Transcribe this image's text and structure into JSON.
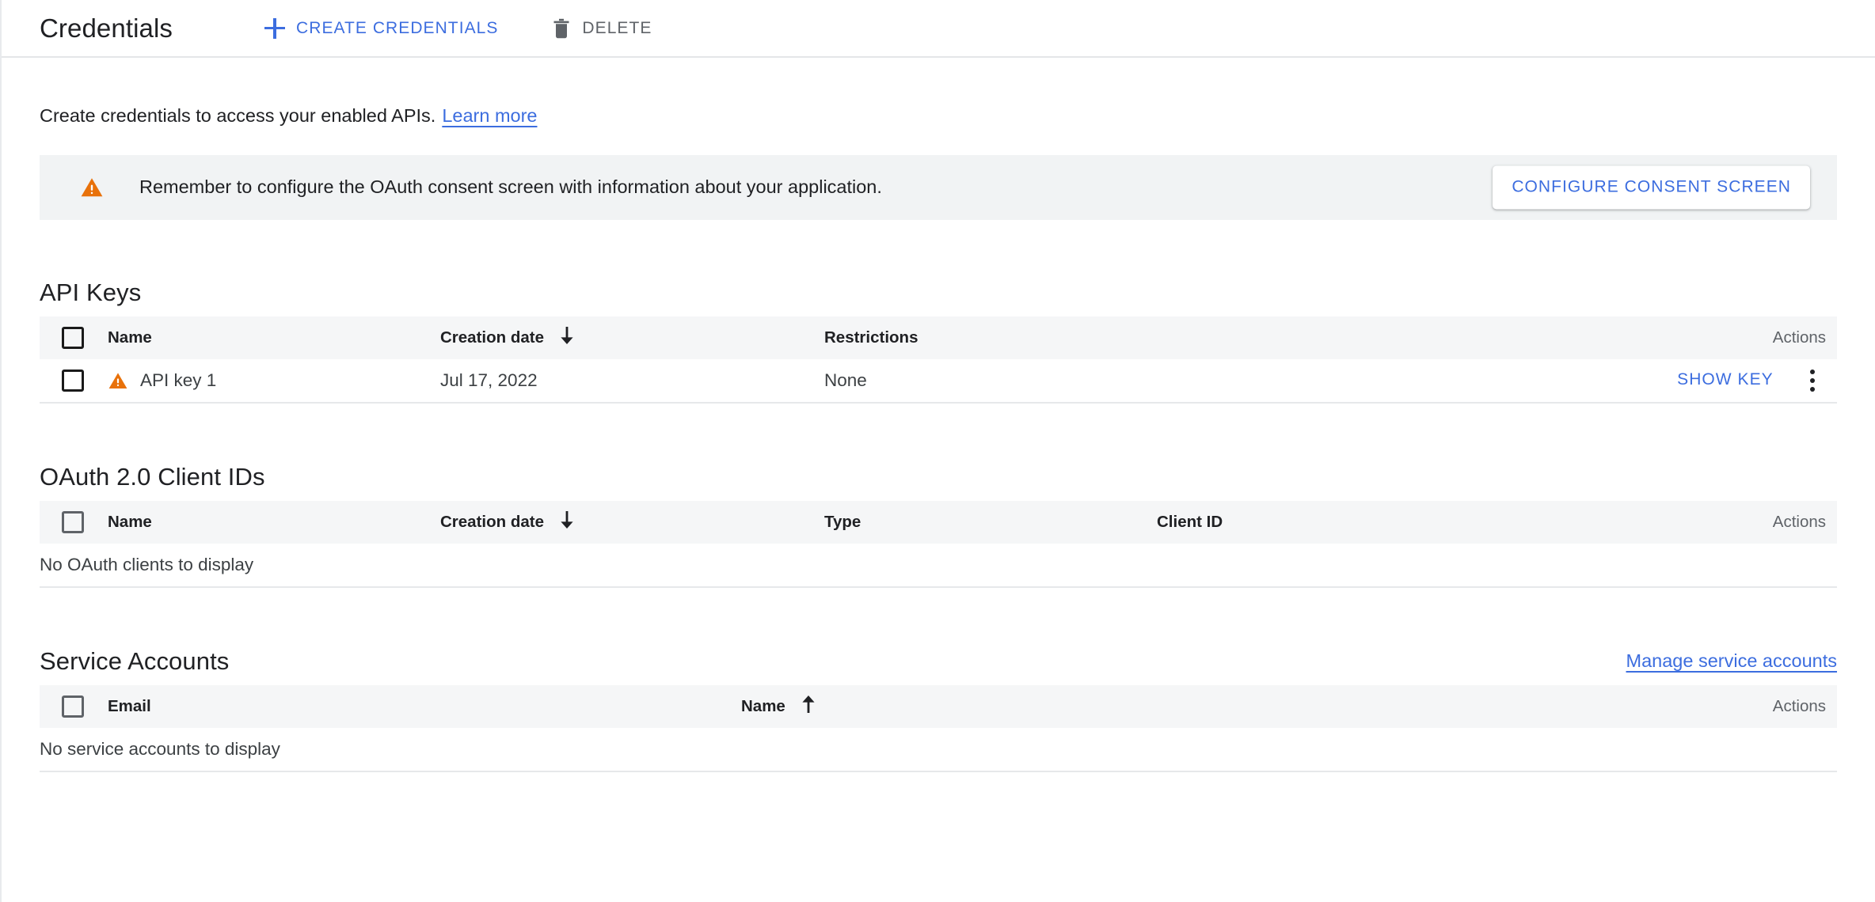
{
  "header": {
    "title": "Credentials",
    "create_button": "CREATE CREDENTIALS",
    "delete_button": "DELETE",
    "create_icon": "plus-icon",
    "delete_icon": "trash-icon",
    "accent_color": "#3c6ddf",
    "muted_color": "#5f6368"
  },
  "intro": {
    "text": "Create credentials to access your enabled APIs.",
    "link": "Learn more"
  },
  "banner": {
    "icon": "warning-triangle-icon",
    "icon_color": "#e8710a",
    "message": "Remember to configure the OAuth consent screen with information about your application.",
    "action": "CONFIGURE CONSENT SCREEN",
    "background": "#f1f3f4"
  },
  "api_keys": {
    "title": "API Keys",
    "columns": {
      "name": "Name",
      "creation_date": "Creation date",
      "restrictions": "Restrictions",
      "actions": "Actions"
    },
    "sort": {
      "column": "Creation date",
      "direction": "descending",
      "glyph": "down-arrow-icon"
    },
    "rows": [
      {
        "warning_icon": "warning-triangle-icon",
        "name": "API key 1",
        "creation_date": "Jul 17, 2022",
        "restrictions": "None",
        "action": "SHOW KEY",
        "menu_icon": "kebab-menu-icon"
      }
    ]
  },
  "oauth_clients": {
    "title": "OAuth 2.0 Client IDs",
    "columns": {
      "name": "Name",
      "creation_date": "Creation date",
      "type": "Type",
      "client_id": "Client ID",
      "actions": "Actions"
    },
    "sort": {
      "column": "Creation date",
      "direction": "descending",
      "glyph": "down-arrow-icon"
    },
    "empty_message": "No OAuth clients to display"
  },
  "service_accounts": {
    "title": "Service Accounts",
    "manage_link": "Manage service accounts",
    "columns": {
      "email": "Email",
      "name": "Name",
      "actions": "Actions"
    },
    "sort": {
      "column": "Name",
      "direction": "ascending",
      "glyph": "up-arrow-icon"
    },
    "empty_message": "No service accounts to display"
  }
}
